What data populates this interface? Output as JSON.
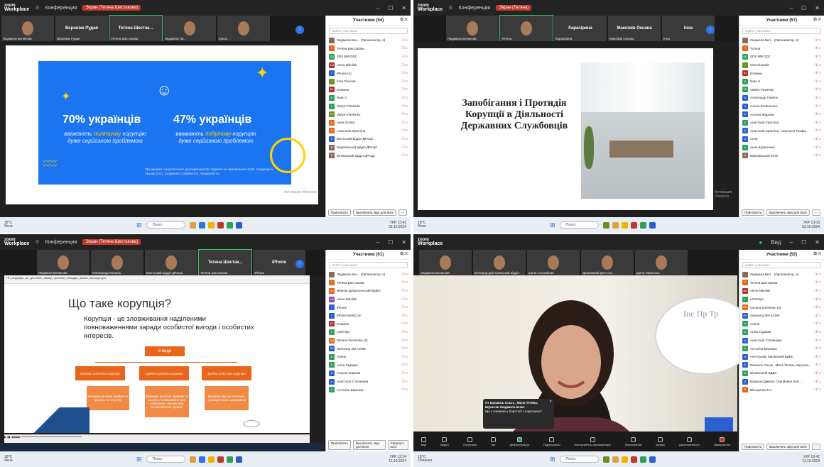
{
  "window": {
    "app_line1": "zoom",
    "app_line2": "Workplace",
    "meeting": "Конференция",
    "share_q1": "Экран (Тетяна Шестакова)",
    "share_q2": "Экран (Тетяна)",
    "share_q3": "Экран (Тетяна Шестакова)",
    "view": "Вид"
  },
  "quad1": {
    "tiles": [
      {
        "name": "Людмила Беликова",
        "label": ""
      },
      {
        "name": "Вероніка Рудая",
        "label": "Вероніка Рудая"
      },
      {
        "name": "Тетяна Шестакова",
        "label": "Тетяна Шестак..."
      },
      {
        "name": "Людмила Ла...",
        "label": ""
      },
      {
        "name": "Ірина...",
        "label": ""
      },
      {
        "name": "Балтський відділ ДРАЦС",
        "label": ""
      }
    ],
    "panel_title": "Участники (54)",
    "search": "Найти участника",
    "participants": [
      "Людмила Бел... (Организатор, я)",
      "Тетяна Шестакова",
      "SDS 886 DDC",
      "Alena Nikolluk",
      "iPhone (2)",
      "Irina Chumak",
      "Юлиана",
      "Nata U.",
      "Vadym Pavlenko",
      "Vadym Pavlenko",
      "Анна Осина",
      "Анастасія Єрастіна",
      "Балтський відділ ДРАЦС",
      "Березівський відділ ДРАЦС",
      "Біляївський відділ ДРАЦС"
    ],
    "avatars": [
      "#8a6b5a",
      "#e8651a",
      "#2e9e5b",
      "#b03030",
      "#2b5fd0",
      "#6b8e23",
      "#b03030",
      "#2e9e5b",
      "#2e9e5b",
      "#6b8e23",
      "#e8651a",
      "#e8651a",
      "#2b5fd0",
      "#8a6b5a",
      "#8a6b5a"
    ],
    "initials": [
      "",
      "Т",
      "SD",
      "AN",
      "i",
      "I",
      "Ю",
      "N",
      "V",
      "VP",
      "А",
      "А",
      "Б",
      "Б",
      "Б"
    ],
    "invite": "Пригласить",
    "mute_all": "Выключить звук для всех",
    "slide": {
      "stat1": "70% українців",
      "sub1a": "вважають ",
      "sub1b": "політичну",
      "sub1c": " корупцію дуже серйозною проблемою",
      "stat2": "47% українців",
      "sub2a": "вважають ",
      "sub2b": "побутову",
      "sub2c": " корупцію дуже серйозною проблемою",
      "note": "*За даними соціологічного дослідження Info Sapiens на замовлення НАЗК «Корупція в Україні 2021: розуміння, сприйняття, поширеність»"
    },
    "activate": "Активация Windows",
    "taskbar": {
      "weather": "18°C",
      "weather2": "Ясно",
      "search": "Поиск",
      "lang": "УКР",
      "time": "13:42",
      "date": "03.10.2024"
    }
  },
  "quad2": {
    "tiles": [
      {
        "name": "Людмила Беликова",
        "label": ""
      },
      {
        "name": "Тетяна",
        "label": ""
      },
      {
        "name": "Карасірина",
        "label": "Карасірина"
      },
      {
        "name": "Максімів Оксана",
        "label": "Максімів Оксана"
      },
      {
        "name": "Інна",
        "label": "Інна"
      },
      {
        "name": "Мерченко Дмитро",
        "label": "Д"
      }
    ],
    "panel_title": "Участники (57)",
    "search": "Найти участника",
    "participants": [
      "Людмила Бел... (Организатор, я)",
      "Тетяна",
      "SDS 886 DDC",
      "Irina Chumak",
      "Юлиана",
      "Nata U.",
      "Vadym Pavlenko",
      "Александр Гавлюк",
      "Алена Литвиненко",
      "Альона Жарова",
      "Анастасія Єрастіна",
      "Анастасія Єрастіна, Анастасія Трефи...",
      "Анна",
      "Анна Щорьченко",
      "Березівський Юлія"
    ],
    "avatars": [
      "#8a6b5a",
      "#e8651a",
      "#2e9e5b",
      "#6b8e23",
      "#b03030",
      "#2e9e5b",
      "#2e9e5b",
      "#2b5fd0",
      "#2b5fd0",
      "#2b5fd0",
      "#2e9e5b",
      "#2b5fd0",
      "#2b5fd0",
      "#2e9e5b",
      "#8a6b5a"
    ],
    "initials": [
      "",
      "Т",
      "SD",
      "I",
      "Ю",
      "N",
      "VP",
      "А",
      "А",
      "А",
      "А",
      "А",
      "А",
      "А",
      "Б"
    ],
    "invite": "Пригласить",
    "mute_all": "Выключить звук для всех",
    "slide_title": "Запобігання і Протидія Корупції в Діяльності Державних Службовців",
    "activate": "Активация Windows",
    "taskbar": {
      "weather": "18°C",
      "weather2": "Ясно",
      "search": "Поиск",
      "lang": "УКР",
      "time": "13:03",
      "date": "03.10.2024"
    }
  },
  "quad3": {
    "tiles": [
      {
        "name": "Людмила Беликова",
        "label": ""
      },
      {
        "name": "Олександр Кошель",
        "label": ""
      },
      {
        "name": "Балтський відділ ДРАЦС",
        "label": ""
      },
      {
        "name": "Тетяна Шестакова",
        "label": "Тетяна Шестак..."
      },
      {
        "name": "iPhone",
        "label": "iPhone"
      },
      {
        "name": "Ірина",
        "label": ""
      }
    ],
    "panel_title": "Участники (61)",
    "search": "Найти участника",
    "participants": [
      "Людмила Бел... (Организатор, я)",
      "Тетяна Шестакова",
      "Иванов Добросельский БДВС",
      "Alena Nikolluk",
      "iPhone",
      "iPhone MobiCom",
      "Юлиана",
      "LOOHQA",
      "Оксана Dovhenko (2)",
      "Samsung SM-A235F",
      "Алена",
      "Аліса Гадарик",
      "Альона Жарова",
      "Анастасія Степанова",
      "Антоніна Березюк"
    ],
    "avatars": [
      "#8a6b5a",
      "#e8651a",
      "#e8651a",
      "#8e44ad",
      "#2b5fd0",
      "#2b5fd0",
      "#b03030",
      "#2e9e5b",
      "#e8651a",
      "#2b5fd0",
      "#2e9e5b",
      "#2e9e5b",
      "#2b5fd0",
      "#2b5fd0",
      "#2e9e5b"
    ],
    "initials": [
      "",
      "Т",
      "И",
      "AN",
      "i",
      "i",
      "Ю",
      "L",
      "OD",
      "SS",
      "А",
      "А",
      "А",
      "А",
      "А"
    ],
    "invite": "Пригласить",
    "mute_all": "Выключить звук для всех",
    "share_all": "Свернуть всех",
    "ppt_path": "НП_Корупція_як_суспільне_явище_причини_наслідки_шляхи_протидії.pptx",
    "slide": {
      "title": "Що таке корупція?",
      "text": "Корупція - це зловживання наділеними повноваженнями заради особистої вигоди і особистих інтересів.",
      "kinds": "3 види",
      "k1": "Велика політична корупція",
      "k2": "Адміністративна корупція",
      "k3": "Дрібна побутова корупція",
      "d1": "виникає на етапі прийняття рішень та законів",
      "d2": "Виникає на етапі прийняття рішень на виконання вже ухвалених законів або встановлених правил",
      "d3": "Виникає під час контакту громадянина із державою"
    },
    "taskbar": {
      "weather": "18°C",
      "weather2": "Ясно",
      "search": "Поиск",
      "lang": "УКР",
      "time": "12:24",
      "date": "11.10.2024"
    }
  },
  "quad4": {
    "tiles": [
      {
        "name": "Людмила Беликова",
        "label": ""
      },
      {
        "name": "Білгород-Дністровський відділ",
        "label": ""
      },
      {
        "name": "Ірина Соловйова",
        "label": ""
      },
      {
        "name": "Державний ДАС Са...",
        "label": ""
      },
      {
        "name": "Ірина Павленко",
        "label": ""
      },
      {
        "name": "Світлана Бійчук",
        "label": ""
      }
    ],
    "panel_title": "Участники (52)",
    "search": "Найти участника",
    "participants": [
      "Людмила Бел... (Организатор, я)",
      "Тетяна Шестакова",
      "Alena Nikolluk",
      "LOOHQA",
      "Оксана Dovhenko (2)",
      "Samsung SM-A235F",
      "Алена",
      "Аліса Гадарик",
      "Анастасія Степанова",
      "Антоніна Березюк",
      "Анн Кушнір Кіровський БДВС",
      "Баланль Ольга , Мала Тетяна, Шульган...",
      "Біляївський БДВС",
      "Борисов Дмитро Сергійович (Іллі...",
      "Вікторенко Р.А."
    ],
    "avatars": [
      "#8a6b5a",
      "#e8651a",
      "#b03030",
      "#2e9e5b",
      "#e8651a",
      "#2b5fd0",
      "#2e9e5b",
      "#2e9e5b",
      "#2b5fd0",
      "#2e9e5b",
      "#2b5fd0",
      "#2b5fd0",
      "#2e9e5b",
      "#2b5fd0",
      "#e8651a"
    ],
    "initials": [
      "",
      "Т",
      "AN",
      "L",
      "OD",
      "SS",
      "А",
      "А",
      "А",
      "А",
      "А",
      "Б",
      "Б",
      "Б",
      "В"
    ],
    "invite": "Пригласить",
    "mute_all": "Выключить звук для всех",
    "toast": {
      "title": "От Баланль Ольга , Мала Тетяна, Шульган Людмила всем:",
      "body": "Що є ознакою у боротьбі з корупцією?"
    },
    "bg_text": "Інс Пр Тр",
    "controls": [
      "Звук",
      "Видео",
      "Участники",
      "Чат",
      "Демонстрация",
      "Подписаться",
      "Инструменты организатора",
      "Приложения",
      "Запись",
      "Дополнительно",
      "Завершение"
    ],
    "participants_count": "52",
    "taskbar": {
      "weather": "19°C",
      "weather2": "Облачно",
      "search": "Поиск",
      "lang": "УКР",
      "time": "13:42",
      "date": "11.10.2024"
    }
  }
}
